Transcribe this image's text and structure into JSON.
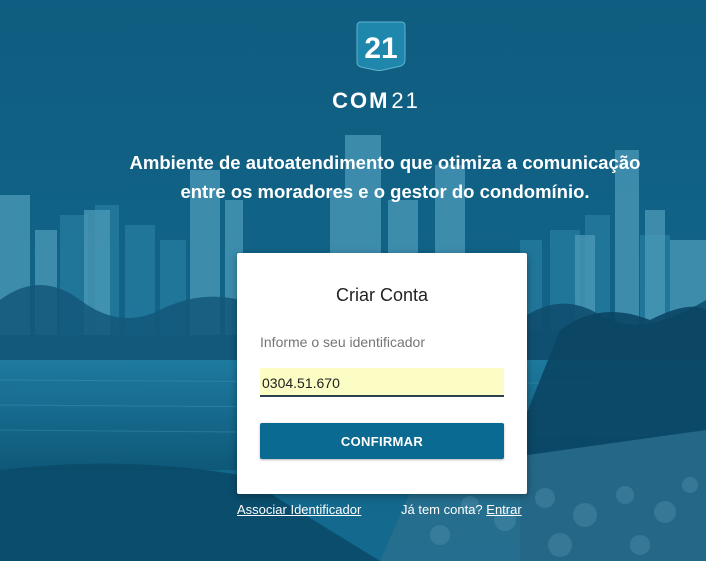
{
  "branding": {
    "logo_number": "21",
    "logo_word_bold": "COM",
    "logo_word_light": "21"
  },
  "tagline": {
    "line1": "Ambiente de autoatendimento que otimiza a comunicação",
    "line2": "entre os moradores e o gestor do condomínio."
  },
  "form": {
    "title": "Criar Conta",
    "identifier_label": "Informe o seu identificador",
    "identifier_value": "0304.51.670",
    "confirm_label": "CONFIRMAR"
  },
  "footer": {
    "associate_link": "Associar Identificador",
    "have_account_text": "Já tem conta?",
    "login_link": "Entrar"
  },
  "colors": {
    "background": "#0d6587",
    "button": "#0b6a92",
    "input_autofill": "#fbfdc5"
  },
  "icons": {
    "logo": "com21-logo-icon"
  }
}
